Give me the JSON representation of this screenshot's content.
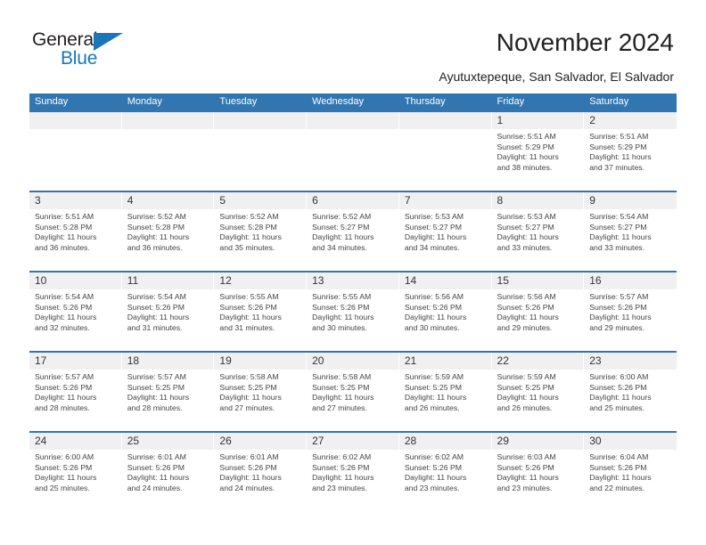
{
  "brand": {
    "name_part1": "General",
    "name_part2": "Blue",
    "logo_icon": "triangle-logo-icon",
    "accent_color": "#1b75bb"
  },
  "header": {
    "title": "November 2024",
    "subtitle": "Ayutuxtepeque, San Salvador, El Salvador"
  },
  "colors": {
    "header_blue": "#3276b1",
    "date_band_gray": "#f0f0f0",
    "text_dark": "#222222"
  },
  "calendar": {
    "day_headers": [
      "Sunday",
      "Monday",
      "Tuesday",
      "Wednesday",
      "Thursday",
      "Friday",
      "Saturday"
    ],
    "weeks": [
      [
        {
          "day": "",
          "lines": []
        },
        {
          "day": "",
          "lines": []
        },
        {
          "day": "",
          "lines": []
        },
        {
          "day": "",
          "lines": []
        },
        {
          "day": "",
          "lines": []
        },
        {
          "day": "1",
          "lines": [
            "Sunrise: 5:51 AM",
            "Sunset: 5:29 PM",
            "Daylight: 11 hours",
            "and 38 minutes."
          ]
        },
        {
          "day": "2",
          "lines": [
            "Sunrise: 5:51 AM",
            "Sunset: 5:29 PM",
            "Daylight: 11 hours",
            "and 37 minutes."
          ]
        }
      ],
      [
        {
          "day": "3",
          "lines": [
            "Sunrise: 5:51 AM",
            "Sunset: 5:28 PM",
            "Daylight: 11 hours",
            "and 36 minutes."
          ]
        },
        {
          "day": "4",
          "lines": [
            "Sunrise: 5:52 AM",
            "Sunset: 5:28 PM",
            "Daylight: 11 hours",
            "and 36 minutes."
          ]
        },
        {
          "day": "5",
          "lines": [
            "Sunrise: 5:52 AM",
            "Sunset: 5:28 PM",
            "Daylight: 11 hours",
            "and 35 minutes."
          ]
        },
        {
          "day": "6",
          "lines": [
            "Sunrise: 5:52 AM",
            "Sunset: 5:27 PM",
            "Daylight: 11 hours",
            "and 34 minutes."
          ]
        },
        {
          "day": "7",
          "lines": [
            "Sunrise: 5:53 AM",
            "Sunset: 5:27 PM",
            "Daylight: 11 hours",
            "and 34 minutes."
          ]
        },
        {
          "day": "8",
          "lines": [
            "Sunrise: 5:53 AM",
            "Sunset: 5:27 PM",
            "Daylight: 11 hours",
            "and 33 minutes."
          ]
        },
        {
          "day": "9",
          "lines": [
            "Sunrise: 5:54 AM",
            "Sunset: 5:27 PM",
            "Daylight: 11 hours",
            "and 33 minutes."
          ]
        }
      ],
      [
        {
          "day": "10",
          "lines": [
            "Sunrise: 5:54 AM",
            "Sunset: 5:26 PM",
            "Daylight: 11 hours",
            "and 32 minutes."
          ]
        },
        {
          "day": "11",
          "lines": [
            "Sunrise: 5:54 AM",
            "Sunset: 5:26 PM",
            "Daylight: 11 hours",
            "and 31 minutes."
          ]
        },
        {
          "day": "12",
          "lines": [
            "Sunrise: 5:55 AM",
            "Sunset: 5:26 PM",
            "Daylight: 11 hours",
            "and 31 minutes."
          ]
        },
        {
          "day": "13",
          "lines": [
            "Sunrise: 5:55 AM",
            "Sunset: 5:26 PM",
            "Daylight: 11 hours",
            "and 30 minutes."
          ]
        },
        {
          "day": "14",
          "lines": [
            "Sunrise: 5:56 AM",
            "Sunset: 5:26 PM",
            "Daylight: 11 hours",
            "and 30 minutes."
          ]
        },
        {
          "day": "15",
          "lines": [
            "Sunrise: 5:56 AM",
            "Sunset: 5:26 PM",
            "Daylight: 11 hours",
            "and 29 minutes."
          ]
        },
        {
          "day": "16",
          "lines": [
            "Sunrise: 5:57 AM",
            "Sunset: 5:26 PM",
            "Daylight: 11 hours",
            "and 29 minutes."
          ]
        }
      ],
      [
        {
          "day": "17",
          "lines": [
            "Sunrise: 5:57 AM",
            "Sunset: 5:26 PM",
            "Daylight: 11 hours",
            "and 28 minutes."
          ]
        },
        {
          "day": "18",
          "lines": [
            "Sunrise: 5:57 AM",
            "Sunset: 5:25 PM",
            "Daylight: 11 hours",
            "and 28 minutes."
          ]
        },
        {
          "day": "19",
          "lines": [
            "Sunrise: 5:58 AM",
            "Sunset: 5:25 PM",
            "Daylight: 11 hours",
            "and 27 minutes."
          ]
        },
        {
          "day": "20",
          "lines": [
            "Sunrise: 5:58 AM",
            "Sunset: 5:25 PM",
            "Daylight: 11 hours",
            "and 27 minutes."
          ]
        },
        {
          "day": "21",
          "lines": [
            "Sunrise: 5:59 AM",
            "Sunset: 5:25 PM",
            "Daylight: 11 hours",
            "and 26 minutes."
          ]
        },
        {
          "day": "22",
          "lines": [
            "Sunrise: 5:59 AM",
            "Sunset: 5:25 PM",
            "Daylight: 11 hours",
            "and 26 minutes."
          ]
        },
        {
          "day": "23",
          "lines": [
            "Sunrise: 6:00 AM",
            "Sunset: 5:26 PM",
            "Daylight: 11 hours",
            "and 25 minutes."
          ]
        }
      ],
      [
        {
          "day": "24",
          "lines": [
            "Sunrise: 6:00 AM",
            "Sunset: 5:26 PM",
            "Daylight: 11 hours",
            "and 25 minutes."
          ]
        },
        {
          "day": "25",
          "lines": [
            "Sunrise: 6:01 AM",
            "Sunset: 5:26 PM",
            "Daylight: 11 hours",
            "and 24 minutes."
          ]
        },
        {
          "day": "26",
          "lines": [
            "Sunrise: 6:01 AM",
            "Sunset: 5:26 PM",
            "Daylight: 11 hours",
            "and 24 minutes."
          ]
        },
        {
          "day": "27",
          "lines": [
            "Sunrise: 6:02 AM",
            "Sunset: 5:26 PM",
            "Daylight: 11 hours",
            "and 23 minutes."
          ]
        },
        {
          "day": "28",
          "lines": [
            "Sunrise: 6:02 AM",
            "Sunset: 5:26 PM",
            "Daylight: 11 hours",
            "and 23 minutes."
          ]
        },
        {
          "day": "29",
          "lines": [
            "Sunrise: 6:03 AM",
            "Sunset: 5:26 PM",
            "Daylight: 11 hours",
            "and 23 minutes."
          ]
        },
        {
          "day": "30",
          "lines": [
            "Sunrise: 6:04 AM",
            "Sunset: 5:26 PM",
            "Daylight: 11 hours",
            "and 22 minutes."
          ]
        }
      ]
    ]
  }
}
